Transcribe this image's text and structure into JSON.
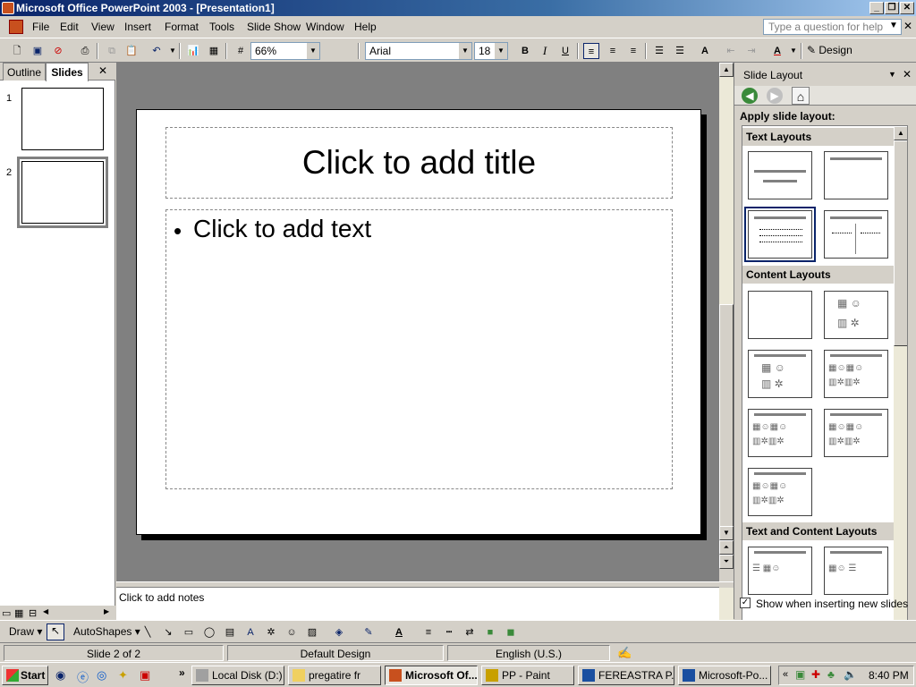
{
  "window": {
    "title": "Microsoft Office PowerPoint 2003 - [Presentation1]"
  },
  "menu": {
    "items": [
      "File",
      "Edit",
      "View",
      "Insert",
      "Format",
      "Tools",
      "Slide Show",
      "Window",
      "Help"
    ],
    "help_placeholder": "Type a question for help"
  },
  "toolbar": {
    "zoom": "66%",
    "font": "Arial",
    "font_size": "18",
    "bold": "B",
    "italic": "I",
    "underline": "U",
    "design_label": "Design"
  },
  "left_pane": {
    "tabs": [
      "Outline",
      "Slides"
    ],
    "close": "✕",
    "slides": [
      "1",
      "2"
    ]
  },
  "slide": {
    "title_placeholder": "Click to add title",
    "bullet": "•",
    "body_placeholder": "Click to add text"
  },
  "notes": {
    "placeholder": "Click to add notes"
  },
  "task_pane": {
    "title": "Slide Layout",
    "apply_label": "Apply slide layout:",
    "sections": [
      "Text Layouts",
      "Content Layouts",
      "Text and Content Layouts"
    ],
    "show_when_inserting": "Show when inserting new slides",
    "show_checked": true
  },
  "draw_toolbar": {
    "draw": "Draw",
    "autoshapes": "AutoShapes"
  },
  "status": {
    "slide": "Slide 2 of 2",
    "design": "Default Design",
    "language": "English (U.S.)"
  },
  "taskbar": {
    "start": "Start",
    "buttons": [
      "Local Disk (D:)",
      "pregatire fr",
      "Microsoft Of...",
      "PP - Paint",
      "FEREASTRA P...",
      "Microsoft-Po..."
    ],
    "clock": "8:40 PM"
  },
  "colors": {
    "title_bar": "#0a246a",
    "selection": "#0a246a",
    "slide_bg": "#ffffff",
    "canvas": "#808080"
  }
}
